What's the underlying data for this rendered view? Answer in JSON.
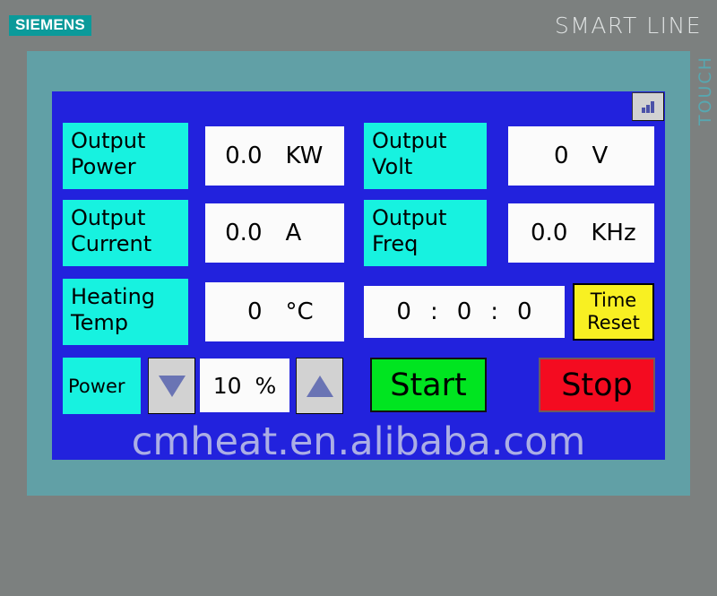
{
  "branding": {
    "vendor": "SIEMENS",
    "product_line": "SMART LINE",
    "panel_type": "TOUCH"
  },
  "screen": {
    "home_button_icon": "bar-chart-icon",
    "rows": [
      {
        "left": {
          "label_line1": "Output",
          "label_line2": "Power",
          "value": "0.0",
          "unit": "KW"
        },
        "right": {
          "label_line1": "Output",
          "label_line2": "Volt",
          "value": "0",
          "unit": "V"
        }
      },
      {
        "left": {
          "label_line1": "Output",
          "label_line2": "Current",
          "value": "0.0",
          "unit": "A"
        },
        "right": {
          "label_line1": "Output",
          "label_line2": "Freq",
          "value": "0.0",
          "unit": "KHz"
        }
      }
    ],
    "temp": {
      "label_line1": "Heating",
      "label_line2": "Temp",
      "value": "0",
      "unit": "°C"
    },
    "timer": {
      "hours": "0",
      "sep1": ":",
      "minutes": "0",
      "sep2": ":",
      "seconds": "0",
      "reset_line1": "Time",
      "reset_line2": "Reset"
    },
    "power_control": {
      "label": "Power",
      "decrement_icon": "triangle-down-icon",
      "increment_icon": "triangle-up-icon",
      "value": "10",
      "unit": "%"
    },
    "actions": {
      "start": "Start",
      "stop": "Stop"
    },
    "watermark": "cmheat.en.alibaba.com"
  },
  "colors": {
    "accent_teal": "#0b9a9a",
    "screen_blue": "#2222dd",
    "label_cyan": "#17f2e0",
    "start_green": "#00e520",
    "stop_red": "#f40b20",
    "reset_yellow": "#f8f022",
    "bezel": "#61a0a6",
    "chassis_gray": "#7c807f"
  }
}
